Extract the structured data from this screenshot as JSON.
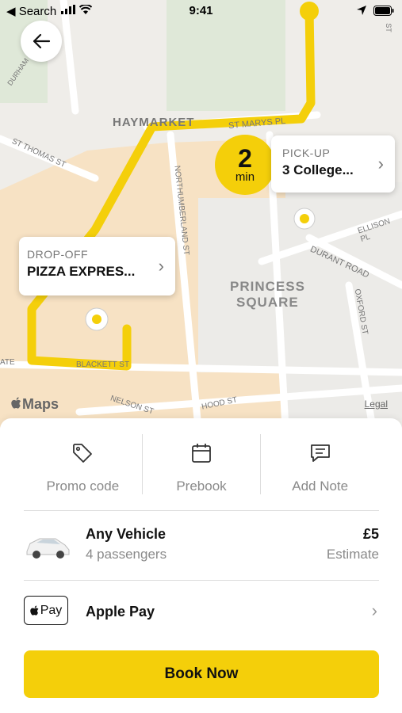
{
  "status_bar": {
    "back_app": "◀ Search",
    "time": "9:41"
  },
  "map": {
    "street_labels": [
      "HAYMARKET",
      "ST MARYS PL",
      "ST THOMAS ST",
      "NORTHUMBERLAND ST",
      "PRINCESS",
      "SQUARE",
      "DURANT ROAD",
      "ELLISON PL",
      "OXFORD ST",
      "BLACKETT ST",
      "NELSON ST",
      "HOOD ST",
      "DURHAM ST",
      "ATE",
      "ST"
    ],
    "maps_logo": "Maps",
    "legal": "Legal",
    "route_color": "#f4cf0a"
  },
  "pickup": {
    "label": "PICK-UP",
    "value": "3 College..."
  },
  "dropoff": {
    "label": "DROP-OFF",
    "value": "PIZZA EXPRES..."
  },
  "eta": {
    "number": "2",
    "unit": "min"
  },
  "actions": [
    {
      "label": "Promo code",
      "icon": "tag-icon"
    },
    {
      "label": "Prebook",
      "icon": "calendar-icon"
    },
    {
      "label": "Add Note",
      "icon": "note-icon"
    }
  ],
  "vehicle": {
    "name": "Any Vehicle",
    "subtitle": "4 passengers",
    "price": "£5",
    "price_note": "Estimate"
  },
  "payment": {
    "badge": "Pay",
    "name": "Apple Pay"
  },
  "book_button": "Book Now",
  "colors": {
    "accent": "#f4cf0a"
  }
}
